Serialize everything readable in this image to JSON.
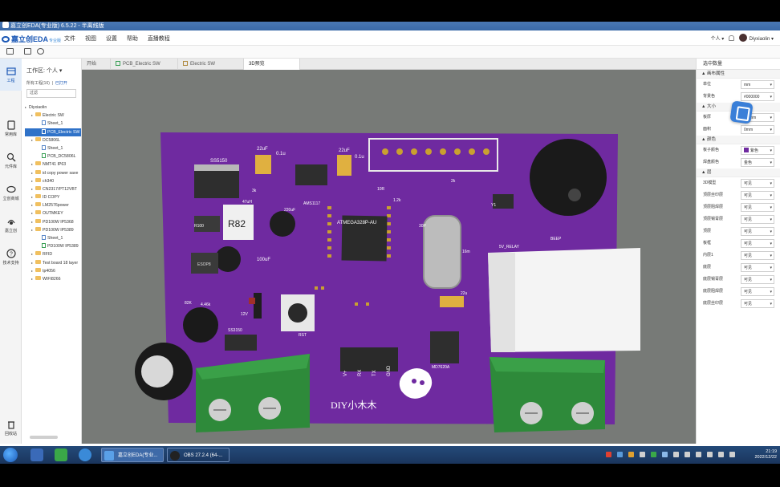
{
  "window_title": "嘉立创EDA(专业版) 6.5.22 - 半离线版",
  "app": {
    "logo": "嘉立创EDA",
    "logo_sub": "专业版"
  },
  "menu": [
    "文件",
    "视图",
    "设置",
    "帮助",
    "直播教程"
  ],
  "user": {
    "team": "个人",
    "name": "Diyxiaolin"
  },
  "left_nav": [
    {
      "label": "工程",
      "icon": "project-icon"
    },
    {
      "label": "常用库",
      "icon": "common-library-icon"
    },
    {
      "label": "元件库",
      "icon": "component-search-icon"
    },
    {
      "label": "立创商城",
      "icon": "lcsc-mall-icon"
    },
    {
      "label": "嘉立创",
      "icon": "jlc-icon"
    },
    {
      "label": "技术支持",
      "icon": "support-icon"
    }
  ],
  "left_nav_bottom": {
    "label": "回收站",
    "icon": "recycle-bin-icon"
  },
  "tree_panel": {
    "workspace": "工作区: 个人",
    "subtitle": "所有工程(16)",
    "subtitle_link": "已打开",
    "filter": "过滤",
    "items": [
      {
        "label": "Diyxiaolin",
        "level": 0,
        "type": "root"
      },
      {
        "label": "Electric SW",
        "level": 1,
        "type": "folder"
      },
      {
        "label": "Sheet_1",
        "level": 2,
        "type": "doc"
      },
      {
        "label": "PCB_Electric SW",
        "level": 2,
        "type": "pcb",
        "selected": true
      },
      {
        "label": "DC5806L",
        "level": 1,
        "type": "folder"
      },
      {
        "label": "Sheet_1",
        "level": 2,
        "type": "doc"
      },
      {
        "label": "PCB_DC5806L",
        "level": 2,
        "type": "pcb"
      },
      {
        "label": "NMT41 IP63",
        "level": 1,
        "type": "folder"
      },
      {
        "label": "id copy power save",
        "level": 1,
        "type": "folder"
      },
      {
        "label": "ch340",
        "level": 1,
        "type": "folder"
      },
      {
        "label": "CN2317/PT12VBT",
        "level": 1,
        "type": "folder"
      },
      {
        "label": "ID COPY",
        "level": 1,
        "type": "folder"
      },
      {
        "label": "LM2576power",
        "level": 1,
        "type": "folder"
      },
      {
        "label": "OUTMKEY",
        "level": 1,
        "type": "folder"
      },
      {
        "label": "PD100W IP5368",
        "level": 1,
        "type": "folder"
      },
      {
        "label": "PD100W IP5389",
        "level": 1,
        "type": "folder"
      },
      {
        "label": "Sheet_1",
        "level": 2,
        "type": "doc"
      },
      {
        "label": "PD100W IP5389",
        "level": 2,
        "type": "pcb"
      },
      {
        "label": "RFID",
        "level": 1,
        "type": "folder"
      },
      {
        "label": "Test board 18 layer",
        "level": 1,
        "type": "folder"
      },
      {
        "label": "tp4056",
        "level": 1,
        "type": "folder"
      },
      {
        "label": "WIFI8266",
        "level": 1,
        "type": "folder"
      }
    ]
  },
  "tabs": [
    {
      "label": "开始",
      "icon": "none"
    },
    {
      "label": "PCB_Electric SW",
      "icon": "pcb"
    },
    {
      "label": "Electric SW",
      "icon": "doc"
    },
    {
      "label": "3D预览",
      "icon": "none",
      "active": true
    }
  ],
  "board": {
    "color": "#6f2aa0",
    "silkscreen": [
      "SS5150",
      "22uF",
      "0.1u",
      "22uF",
      "0.1u",
      "AMS1117",
      "47uH",
      "3k",
      "R82",
      "220uF",
      "100uF",
      "R100",
      "ESOP8",
      "82K",
      "4.46k",
      "SS3150",
      "12V",
      "RST",
      "ATMEGA328P-AU",
      "30P",
      "16m",
      "5V_RELAY",
      "BEEP",
      "Y1",
      "10R",
      "1.2k",
      "2k",
      "V+",
      "RX",
      "TX",
      "GND",
      "22u",
      "MD7620A",
      "DIY小木木",
      "0.1u",
      "10k",
      "1k",
      "Gen",
      "1x",
      "Ok",
      "8x"
    ],
    "chip_main": "ATMEGA328P-AU",
    "resistor_label": "R82",
    "brand_text": "DIY小木木"
  },
  "right_panel": {
    "title": "选中数量",
    "sections": [
      {
        "header": "▲ 画布属性",
        "rows": [
          {
            "label": "单位",
            "value": "mm"
          },
          {
            "label": "背景色",
            "value": "#000000"
          }
        ]
      },
      {
        "header": "▲ 大小",
        "rows": [
          {
            "label": "板厚",
            "value": "1.6mm"
          },
          {
            "label": "面积",
            "value": "0mm"
          }
        ]
      },
      {
        "header": "▲ 颜色",
        "rows": [
          {
            "label": "板子颜色",
            "value": "紫色"
          },
          {
            "label": "焊盘颜色",
            "value": "金色"
          }
        ]
      },
      {
        "header": "▲ 层",
        "rows": [
          {
            "label": "3D模型",
            "value": "可见"
          },
          {
            "label": "顶层丝印层",
            "value": "可见"
          },
          {
            "label": "顶层阻焊层",
            "value": "可见"
          },
          {
            "label": "顶层锡膏层",
            "value": "可见"
          },
          {
            "label": "顶层",
            "value": "可见"
          },
          {
            "label": "板框",
            "value": "可见"
          },
          {
            "label": "内层1",
            "value": "可见"
          },
          {
            "label": "底层",
            "value": "可见"
          },
          {
            "label": "底层锡膏层",
            "value": "可见"
          },
          {
            "label": "底层阻焊层",
            "value": "可见"
          },
          {
            "label": "底层丝印层",
            "value": "可见"
          }
        ]
      }
    ]
  },
  "taskbar": {
    "tasks": [
      {
        "label": "嘉立创EDA(专业...",
        "icon": "jlceda-task-icon"
      },
      {
        "label": "OBS 27.2.4 (64-...",
        "icon": "obs-task-icon"
      }
    ],
    "time": "21:19",
    "date": "2022/12/22"
  }
}
